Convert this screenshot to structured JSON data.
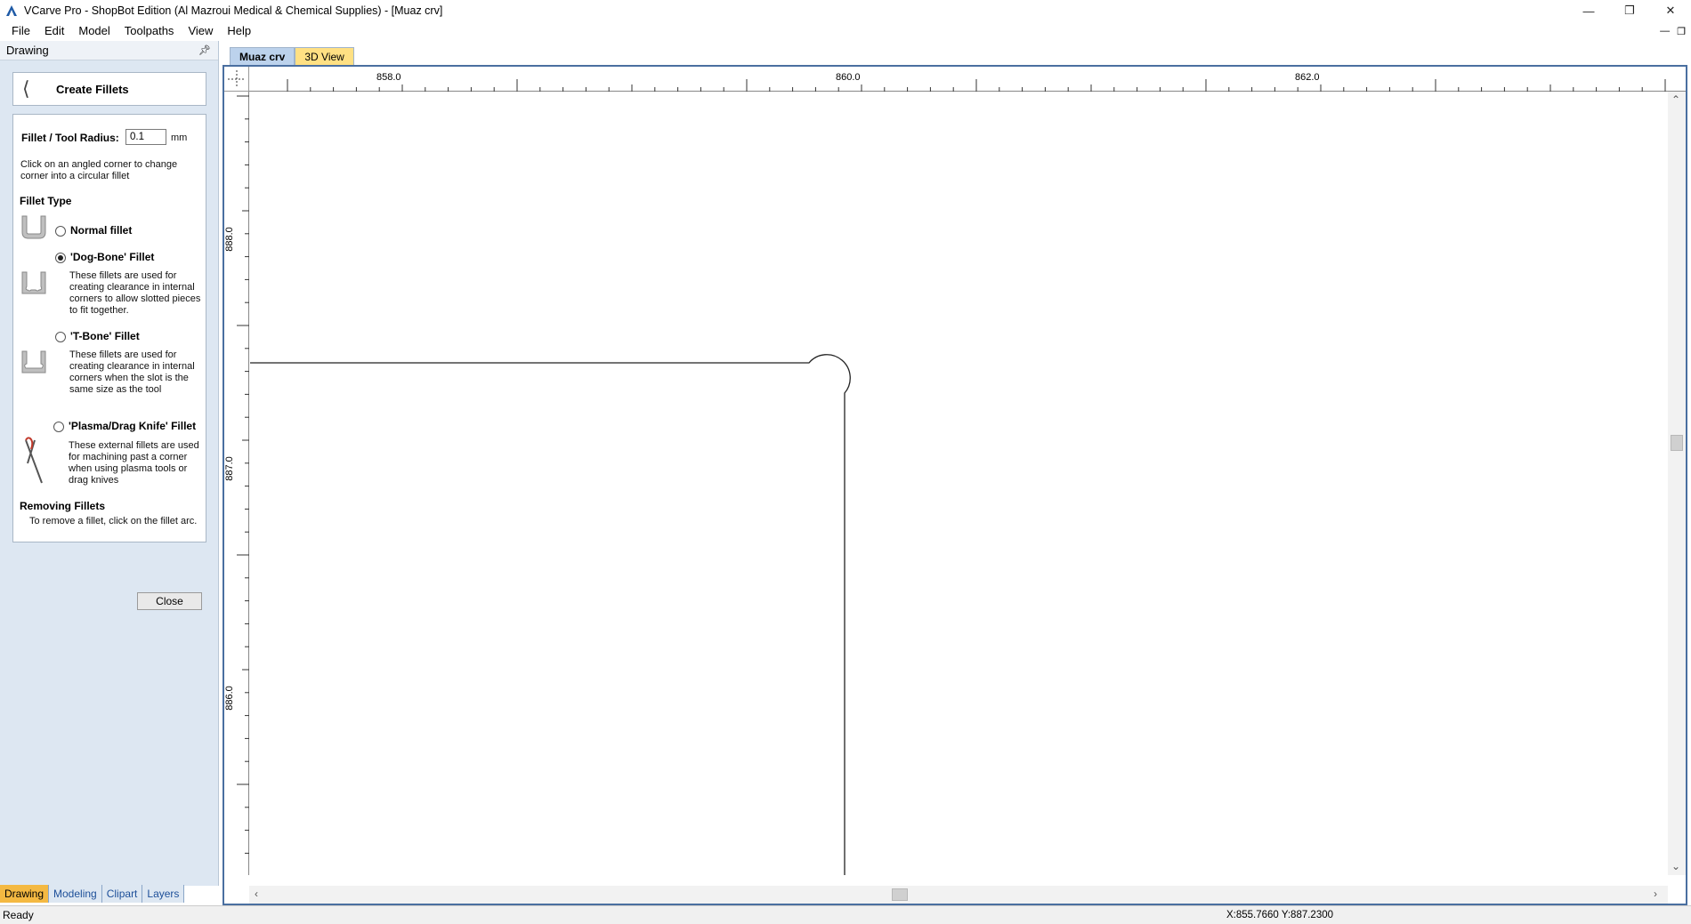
{
  "window": {
    "title": "VCarve Pro - ShopBot Edition (Al Mazroui Medical & Chemical Supplies) - [Muaz crv]"
  },
  "menu": [
    "File",
    "Edit",
    "Model",
    "Toolpaths",
    "View",
    "Help"
  ],
  "panel": {
    "header": "Drawing",
    "form_title": "Create Fillets",
    "radius_label": "Fillet / Tool Radius:",
    "radius_value": "0.1",
    "radius_unit": "mm",
    "instruction": "Click on an angled corner to change corner into a circular fillet",
    "fillet_type_heading": "Fillet Type",
    "options": [
      {
        "label": "Normal fillet",
        "description": "",
        "checked": false
      },
      {
        "label": "'Dog-Bone' Fillet",
        "description": "These fillets are used for creating clearance in internal corners to allow slotted pieces to fit together.",
        "checked": true
      },
      {
        "label": "'T-Bone' Fillet",
        "description": "These fillets are used for creating clearance in internal corners when the slot is the same size as the tool",
        "checked": false
      },
      {
        "label": "'Plasma/Drag Knife' Fillet",
        "description": "These external fillets are used for machining past a corner when using plasma tools or drag knives",
        "checked": false
      }
    ],
    "removing_heading": "Removing Fillets",
    "removing_text": "To remove a fillet, click on the fillet arc.",
    "close_label": "Close"
  },
  "bottom_tabs": [
    {
      "label": "Drawing",
      "active": true
    },
    {
      "label": "Modeling",
      "active": false
    },
    {
      "label": "Clipart",
      "active": false
    },
    {
      "label": "Layers",
      "active": false
    }
  ],
  "doc_tabs": [
    {
      "label": "Muaz crv",
      "active": true
    },
    {
      "label": "3D View",
      "active": false
    }
  ],
  "rulers": {
    "horizontal_labels": [
      "858.0",
      "860.0",
      "862.0"
    ],
    "vertical_labels": [
      "888.0",
      "887.0",
      "886.0"
    ]
  },
  "status": {
    "text": "Ready",
    "coords": "X:855.7660 Y:887.2300"
  },
  "colors": {
    "panel_bg": "#dde7f2",
    "active_tab": "#f4b942",
    "doc_tab_active": "#bcd2ec",
    "doc_tab_inactive": "#ffe083",
    "frame_border": "#4a6fa0"
  }
}
